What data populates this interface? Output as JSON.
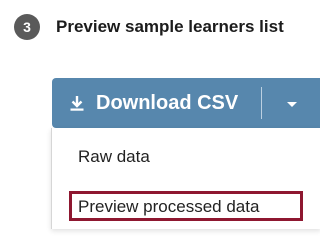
{
  "step": {
    "number": "3",
    "title": "Preview sample learners list"
  },
  "download_button": {
    "label": "Download CSV",
    "icon": "download-icon",
    "color": "#5787ad"
  },
  "dropdown": {
    "caret_icon": "chevron-down-icon",
    "items": [
      {
        "label": "Raw data"
      },
      {
        "label": "Preview processed data",
        "highlighted": true
      }
    ]
  },
  "highlight_color": "#8e1730"
}
